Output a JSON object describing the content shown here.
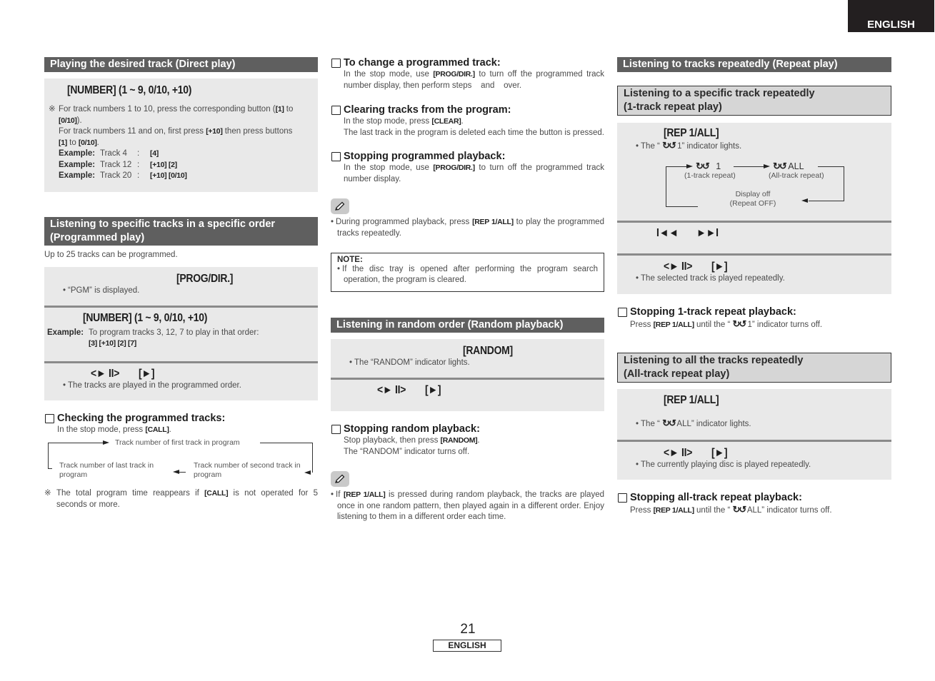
{
  "top_tab": "ENGLISH",
  "footer": {
    "page_number": "21",
    "language": "ENGLISH"
  },
  "col1": {
    "direct": {
      "header": "Playing the desired track (Direct play)",
      "key": "[NUMBER] (1 ~ 9, 0/10, +10)",
      "note_mark": "※",
      "line1a": "For track numbers 1 to 10, press the corresponding button (",
      "line1b": "[1]",
      "line1c": " to ",
      "line1d": "[0/10]",
      "line1e": ").",
      "line2a": "For track numbers 11 and on, first press ",
      "line2b": "[+10]",
      "line2c": " then press buttons ",
      "line2d": "[1]",
      "line2e": " to ",
      "line2f": "[0/10]",
      "line2g": ".",
      "examples": [
        {
          "label": "Example:",
          "track": "Track 4",
          "sep": ":",
          "keys": "[4]"
        },
        {
          "label": "Example:",
          "track": "Track 12",
          "sep": ":",
          "keys": "[+10] [2]"
        },
        {
          "label": "Example:",
          "track": "Track 20",
          "sep": ":",
          "keys": "[+10] [0/10]"
        }
      ]
    },
    "programmed": {
      "header_line1": "Listening to specific tracks in a specific order",
      "header_line2": "(Programmed play)",
      "intro": "Up to 25 tracks can be programmed.",
      "step1_key": "[PROG/DIR.]",
      "step1_note": "“PGM” is displayed.",
      "step2_key": "[NUMBER] (1 ~ 9, 0/10, +10)",
      "step2_example_label": "Example:",
      "step2_example_text": "To program tracks 3, 12, 7 to play in that order:",
      "step2_example_keys": "[3] [+10] [2] [7]",
      "step3_key_a": "<► II>",
      "step3_key_b": "[►]",
      "step3_note": "The tracks are played in the programmed order."
    },
    "checking": {
      "title": "Checking the programmed tracks:",
      "text_a": "In the stop mode, press ",
      "text_b": "[CALL]",
      "text_c": ".",
      "diagram": {
        "first": "Track number of first track in program",
        "last": "Track number of last track in program",
        "second": "Track number of second track in program"
      },
      "note_mark": "※",
      "note_a": "The total program time reappears if ",
      "note_b": "[CALL]",
      "note_c": " is not operated for 5 seconds or more."
    }
  },
  "col2": {
    "change": {
      "title": "To change a programmed track:",
      "text_a": "In the stop mode, use ",
      "text_b": "[PROG/DIR.]",
      "text_c": " to turn off the programmed track number display, then perform steps    and    over."
    },
    "clearing": {
      "title": "Clearing tracks from the program:",
      "text_a": "In the stop mode, press ",
      "text_b": "[CLEAR]",
      "text_c": ".",
      "text2": "The last track in the program is deleted each time the button is pressed."
    },
    "stopping_prog": {
      "title": "Stopping programmed playback:",
      "text_a": "In the stop mode, use ",
      "text_b": "[PROG/DIR.]",
      "text_c": " to turn off the programmed track number display."
    },
    "memo1": {
      "text_a": "During programmed playback, press ",
      "text_b": "[REP 1/ALL]",
      "text_c": " to play the programmed tracks repeatedly."
    },
    "note": {
      "label": "NOTE:",
      "text": "If the disc tray is opened after performing the program search operation, the program is cleared."
    },
    "random": {
      "header": "Listening in random order (Random playback)",
      "step1_key": "[RANDOM]",
      "step1_note": "The “RANDOM” indicator lights.",
      "step2_key_a": "<► II>",
      "step2_key_b": "[►]"
    },
    "stopping_random": {
      "title": "Stopping random playback:",
      "text_a": "Stop playback, then press ",
      "text_b": "[RANDOM]",
      "text_c": ".",
      "text2": "The “RANDOM” indicator turns off."
    },
    "memo2": {
      "text_a": "If ",
      "text_b": "[REP 1/ALL]",
      "text_c": " is pressed during random playback, the tracks are played once in one random pattern, then played again in a different order. Enjoy listening to them in a different order each time."
    }
  },
  "col3": {
    "header": "Listening to tracks repeatedly (Repeat play)",
    "one_track": {
      "subheader_line1": "Listening to a specific track repeatedly",
      "subheader_line2": "(1-track repeat play)",
      "step1_key": "[REP 1/ALL]",
      "step1_note_a": "The “ ",
      "step1_note_b": " 1” indicator lights.",
      "diagram": {
        "one": "1",
        "one_label": "(1-track repeat)",
        "all": "ALL",
        "all_label": "(All-track repeat)",
        "off_line1": "Display off",
        "off_line2": "(Repeat OFF)"
      },
      "step2_key_a": "I◄◄",
      "step2_key_b": "►►I",
      "step3_key_a": "<► II>",
      "step3_key_b": "[►]",
      "step3_note": "The selected track is played repeatedly."
    },
    "stopping_one": {
      "title": "Stopping 1-track repeat playback:",
      "text_a": "Press ",
      "text_b": "[REP 1/ALL]",
      "text_c": " until the “ ",
      "text_d": " 1” indicator turns off."
    },
    "all_track": {
      "subheader_line1": "Listening to all the tracks repeatedly",
      "subheader_line2": "(All-track repeat play)",
      "step1_key": "[REP 1/ALL]",
      "step1_note_a": "The “ ",
      "step1_note_b": " ALL” indicator lights.",
      "step2_key_a": "<► II>",
      "step2_key_b": "[►]",
      "step2_note": "The currently playing disc is played repeatedly."
    },
    "stopping_all": {
      "title": "Stopping all-track repeat playback:",
      "text_a": "Press ",
      "text_b": "[REP 1/ALL]",
      "text_c": " until the “ ",
      "text_d": " ALL” indicator turns off."
    },
    "repeat_icon": "⟲⟳"
  }
}
